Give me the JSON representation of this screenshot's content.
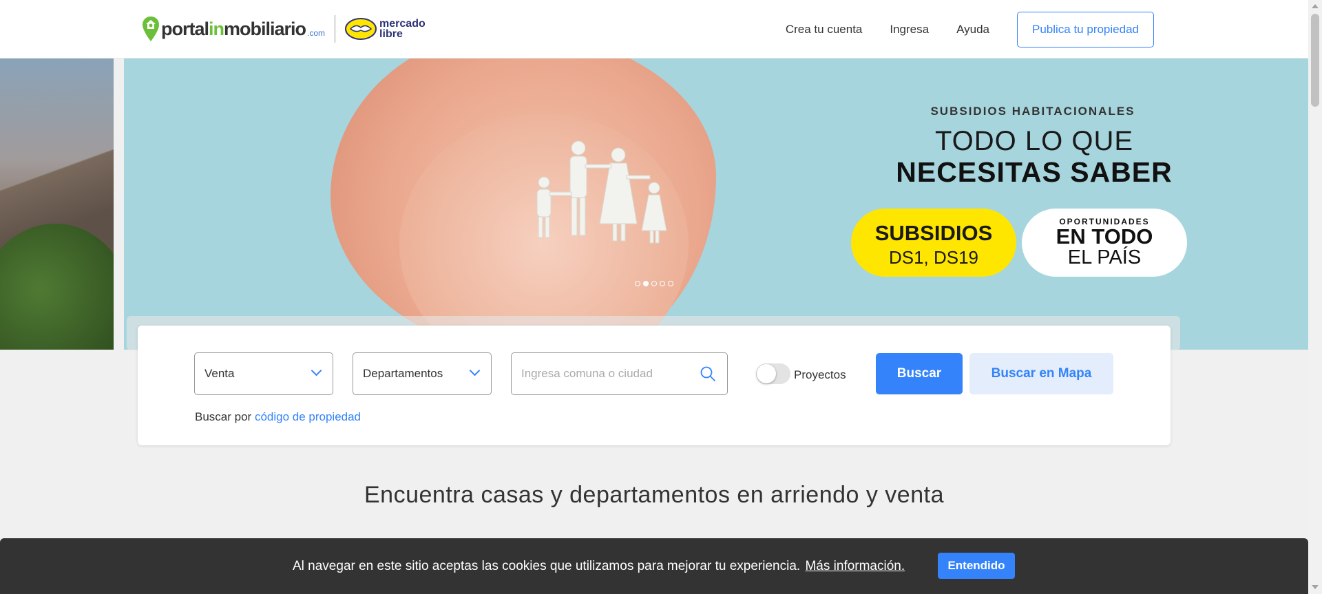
{
  "header": {
    "logo": {
      "part1": "portal",
      "part2": "in",
      "part3": "mobiliario",
      "suffix": ".com"
    },
    "partner_logo": {
      "line1": "mercado",
      "line2": "libre"
    },
    "nav": [
      "Crea tu cuenta",
      "Ingresa",
      "Ayuda"
    ],
    "cta_label": "Publica tu propiedad"
  },
  "hero": {
    "kicker": "SUBSIDIOS HABITACIONALES",
    "title_line1": "TODO LO QUE",
    "title_line2": "NECESITAS SABER",
    "pill_yellow": {
      "big": "SUBSIDIOS",
      "small": "DS1, DS19"
    },
    "pill_white": {
      "tiny": "OPORTUNIDADES",
      "big": "EN TODO",
      "mid": "EL PAÍS"
    },
    "carousel_dots": 5,
    "carousel_active_index": 1
  },
  "search": {
    "operation_value": "Venta",
    "property_type_value": "Departamentos",
    "location_placeholder": "Ingresa comuna o ciudad",
    "projects_toggle_label": "Proyectos",
    "projects_toggle_on": false,
    "search_button": "Buscar",
    "map_button": "Buscar en Mapa",
    "code_prefix": "Buscar por",
    "code_link": "código de propiedad"
  },
  "main": {
    "headline": "Encuentra casas y departamentos en arriendo y venta"
  },
  "cookie_bar": {
    "text": "Al navegar en este sitio aceptas las cookies que utilizamos para mejorar tu experiencia.",
    "link": "Más información.",
    "button": "Entendido"
  },
  "colors": {
    "accent": "#3483fa",
    "brand_green": "#6bbf3b",
    "promo_yellow": "#ffe600",
    "hero_bg": "#a7d5dd",
    "cookie_bg": "#333333"
  }
}
